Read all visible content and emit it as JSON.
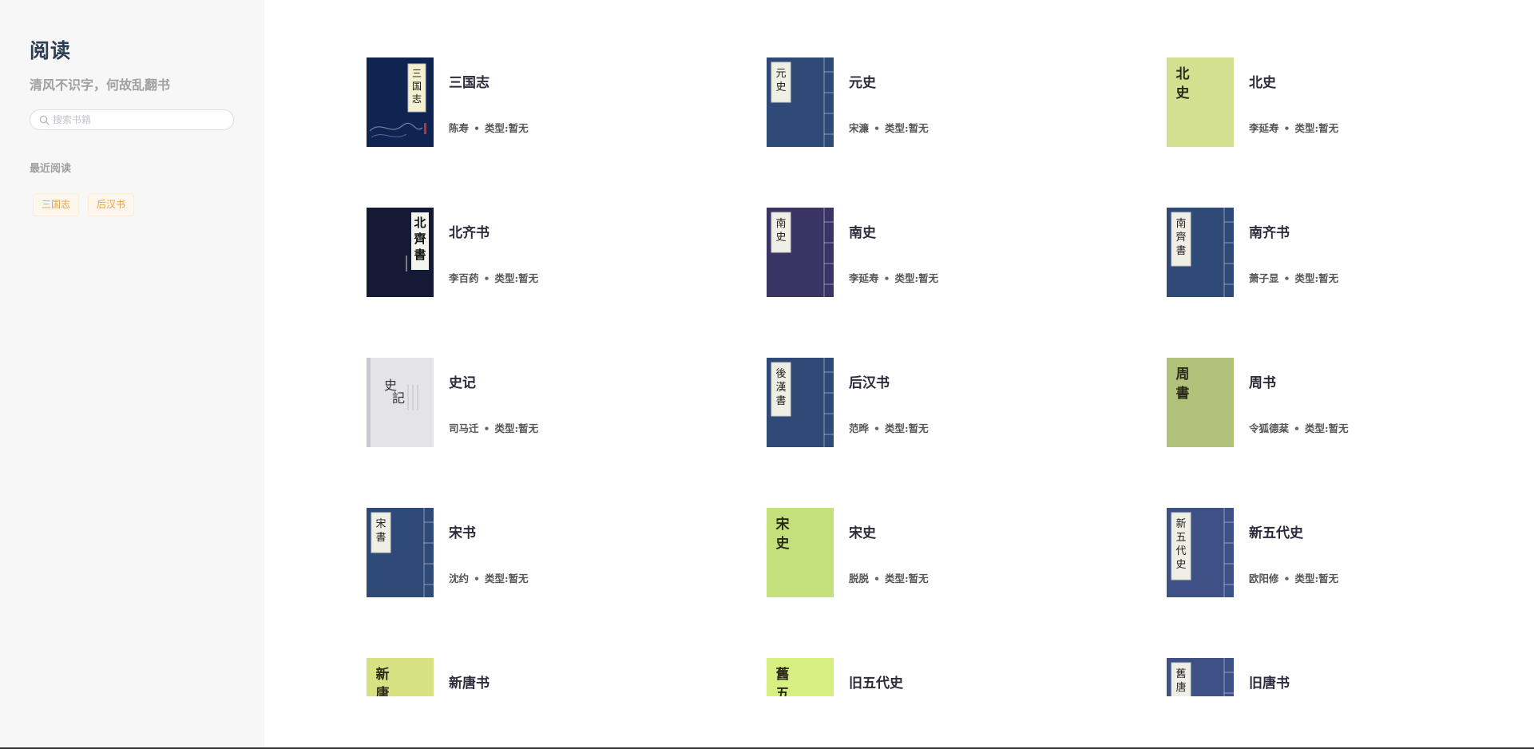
{
  "sidebar": {
    "title": "阅读",
    "subtitle": "清风不识字，何故乱翻书",
    "search": {
      "placeholder": "搜索书籍",
      "value": ""
    },
    "recent_heading": "最近阅读",
    "recent_items": [
      "三国志",
      "后汉书"
    ]
  },
  "books": [
    {
      "title": "三国志",
      "author": "陈寿",
      "type": "类型:暂无",
      "cover_style": "navy-dragon",
      "cover_text": "三国志",
      "cover_color": "#0f2451"
    },
    {
      "title": "元史",
      "author": "宋濂",
      "type": "类型:暂无",
      "cover_style": "blue-bound",
      "cover_text": "元史",
      "cover_color": "#2f4a76"
    },
    {
      "title": "北史",
      "author": "李延寿",
      "type": "类型:暂无",
      "cover_style": "pale-green",
      "cover_text": "北史",
      "cover_color": "#d3e08f"
    },
    {
      "title": "北齐书",
      "author": "李百药",
      "type": "类型:暂无",
      "cover_style": "dark-navy",
      "cover_text": "北齊書",
      "cover_color": "#141a33"
    },
    {
      "title": "南史",
      "author": "李延寿",
      "type": "类型:暂无",
      "cover_style": "purple-bound",
      "cover_text": "南史",
      "cover_color": "#3a3465"
    },
    {
      "title": "南齐书",
      "author": "萧子显",
      "type": "类型:暂无",
      "cover_style": "blue-bound",
      "cover_text": "南齊書",
      "cover_color": "#2f4a76"
    },
    {
      "title": "史记",
      "author": "司马迁",
      "type": "类型:暂无",
      "cover_style": "white-paper",
      "cover_text": "史記",
      "cover_color": "#e4e4e8"
    },
    {
      "title": "后汉书",
      "author": "范晔",
      "type": "类型:暂无",
      "cover_style": "blue-bound",
      "cover_text": "後漢書",
      "cover_color": "#2f4a76"
    },
    {
      "title": "周书",
      "author": "令狐德棻",
      "type": "类型:暂无",
      "cover_style": "olive-green",
      "cover_text": "周書",
      "cover_color": "#b2c17a"
    },
    {
      "title": "宋书",
      "author": "沈约",
      "type": "类型:暂无",
      "cover_style": "blue-bound",
      "cover_text": "宋書",
      "cover_color": "#2f4a76"
    },
    {
      "title": "宋史",
      "author": "脱脱",
      "type": "类型:暂无",
      "cover_style": "lime-green",
      "cover_text": "宋史",
      "cover_color": "#c3e07a"
    },
    {
      "title": "新五代史",
      "author": "欧阳修",
      "type": "类型:暂无",
      "cover_style": "blue-bound",
      "cover_text": "新五代史",
      "cover_color": "#3d5187"
    },
    {
      "title": "新唐书",
      "author": "",
      "type": "",
      "cover_style": "pale-green",
      "cover_text": "新唐",
      "cover_color": "#d6e282"
    },
    {
      "title": "旧五代史",
      "author": "",
      "type": "",
      "cover_style": "lime-green",
      "cover_text": "舊五",
      "cover_color": "#d7ef80"
    },
    {
      "title": "旧唐书",
      "author": "",
      "type": "",
      "cover_style": "blue-bound",
      "cover_text": "舊唐",
      "cover_color": "#3d5187"
    }
  ]
}
